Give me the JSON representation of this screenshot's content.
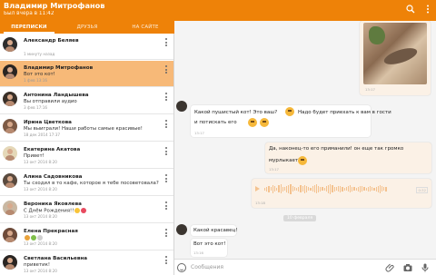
{
  "header": {
    "title": "Владимир Митрофанов",
    "subtitle": "Был вчера в 11:42",
    "icons": [
      "search-icon",
      "more-vert-icon"
    ],
    "color": "#ee8208"
  },
  "tabs": [
    {
      "label": "ПЕРЕПИСКИ",
      "active": true
    },
    {
      "label": "ДРУЗЬЯ",
      "active": false
    },
    {
      "label": "НА САЙТЕ",
      "active": false
    }
  ],
  "conversations": [
    {
      "name": "Александр Беляев",
      "preview": "",
      "time": "1 минуту назад"
    },
    {
      "name": "Владимир Митрофанов",
      "preview": "Вот это кот!",
      "time": "1 фев 13:16",
      "selected": true
    },
    {
      "name": "Антонина Ландышева",
      "preview": "Вы отправили аудио",
      "time": "3 фев 17:16"
    },
    {
      "name": "Ирина Цветкова",
      "preview": "Мы выиграли! Наши работы самые красивые!",
      "time": "18 дек 2014 17:37"
    },
    {
      "name": "Екатерина Акатова",
      "preview": "Привет!",
      "time": "13 окт 2014 8:20"
    },
    {
      "name": "Алина Садовникова",
      "preview": "Ты сходил в то кафе, которое я тебе посоветовала?",
      "time": "13 окт 2014 8:20"
    },
    {
      "name": "Вероника Яковлева",
      "preview": "С Днём Рождения!!",
      "time": "13 окт 2014 8:20"
    },
    {
      "name": "Елена Прекрасная",
      "preview": "",
      "time": "13 окт 2014 8:20"
    },
    {
      "name": "Светлана Васильевна",
      "preview": "приветик!",
      "time": "13 окт 2014 8:20"
    }
  ],
  "messages": [
    {
      "type": "photo",
      "time": "13:17"
    },
    {
      "type": "text",
      "part1": "Какой пушистый кот! Это ваш?",
      "part2": "Надо будет приехать к вам в гости",
      "part3": "и потискать его",
      "time": "13:17"
    },
    {
      "type": "text",
      "part1": "Да, наконец-то его приманили! он еще так громко",
      "part2": "мурлыкает!",
      "time": "13:17"
    },
    {
      "type": "audio",
      "duration": "0:32",
      "time": "13:18"
    },
    {
      "type": "date",
      "label": "10 февраля"
    },
    {
      "type": "text",
      "part1": "Какой красавец!"
    },
    {
      "type": "text",
      "part1": "Вот это кот!",
      "time": "13:16"
    }
  ],
  "composer": {
    "placeholder": "Сообщения",
    "icons": [
      "emoji-icon",
      "attach-icon",
      "camera-icon",
      "mic-icon"
    ]
  }
}
